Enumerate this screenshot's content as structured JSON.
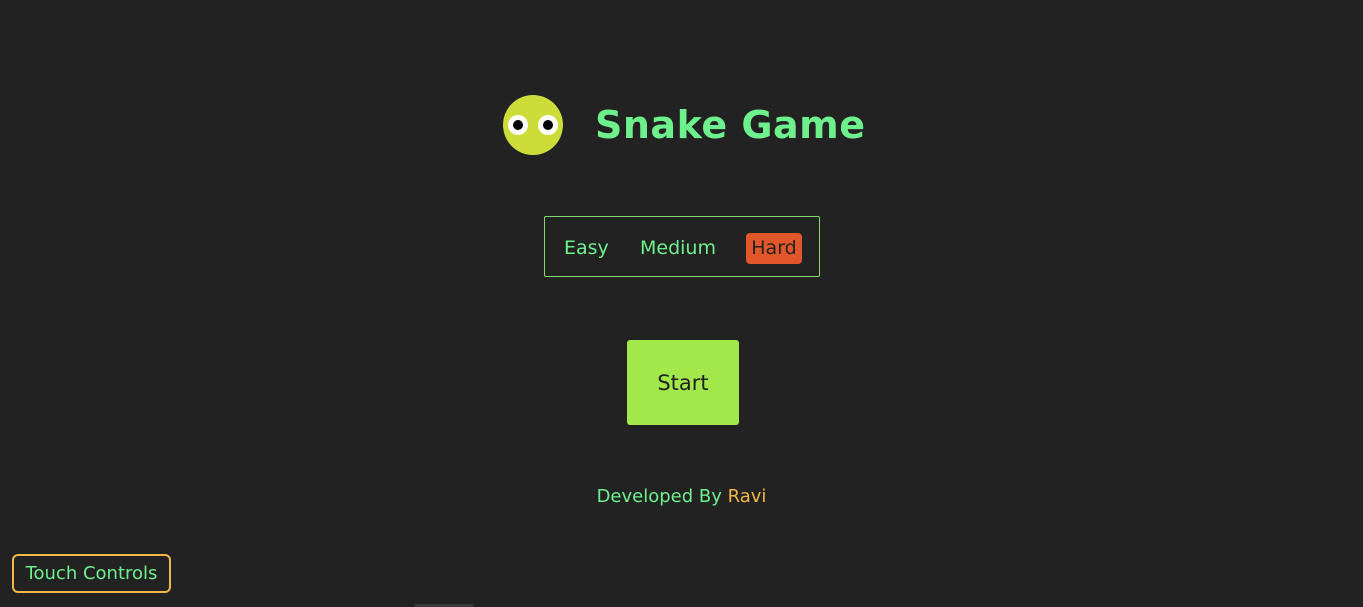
{
  "header": {
    "title": "Snake Game",
    "logo_icon": "snake-face-icon"
  },
  "difficulty": {
    "options": [
      {
        "label": "Easy",
        "selected": false
      },
      {
        "label": "Medium",
        "selected": false
      },
      {
        "label": "Hard",
        "selected": true
      }
    ]
  },
  "start_button": {
    "label": "Start"
  },
  "footer": {
    "developed_by": "Developed By",
    "author": "Ravi"
  },
  "touch_controls": {
    "label": "Touch Controls"
  },
  "colors": {
    "background": "#222222",
    "accent_text": "#6ef08d",
    "logo_yellow": "#cddc39",
    "start_green": "#a2e84a",
    "selected_orange": "#e2572a",
    "author_gold": "#f1b748"
  }
}
